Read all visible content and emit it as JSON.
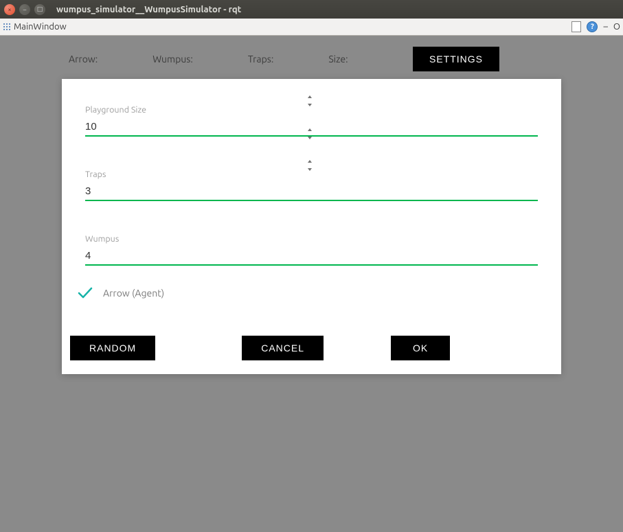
{
  "window_title": "wumpus_simulator__WumpusSimulator - rqt",
  "menu_label": "MainWindow",
  "titlebar_right": {
    "dash": "–",
    "circle": "O"
  },
  "status": {
    "arrow_label": "Arrow:",
    "wumpus_label": "Wumpus:",
    "traps_label": "Traps:",
    "size_label": "Size:",
    "settings_button": "SETTINGS"
  },
  "dialog": {
    "fields": {
      "playground": {
        "label": "Playground Size",
        "value": "10"
      },
      "traps": {
        "label": "Traps",
        "value": "3"
      },
      "wumpus": {
        "label": "Wumpus",
        "value": "4"
      }
    },
    "checkbox": {
      "label": "Arrow (Agent)",
      "checked": true
    },
    "buttons": {
      "random": "RANDOM",
      "cancel": "CANCEL",
      "ok": "OK"
    }
  },
  "colors": {
    "accent_green": "#00b64e",
    "accent_teal": "#16b3a8"
  }
}
